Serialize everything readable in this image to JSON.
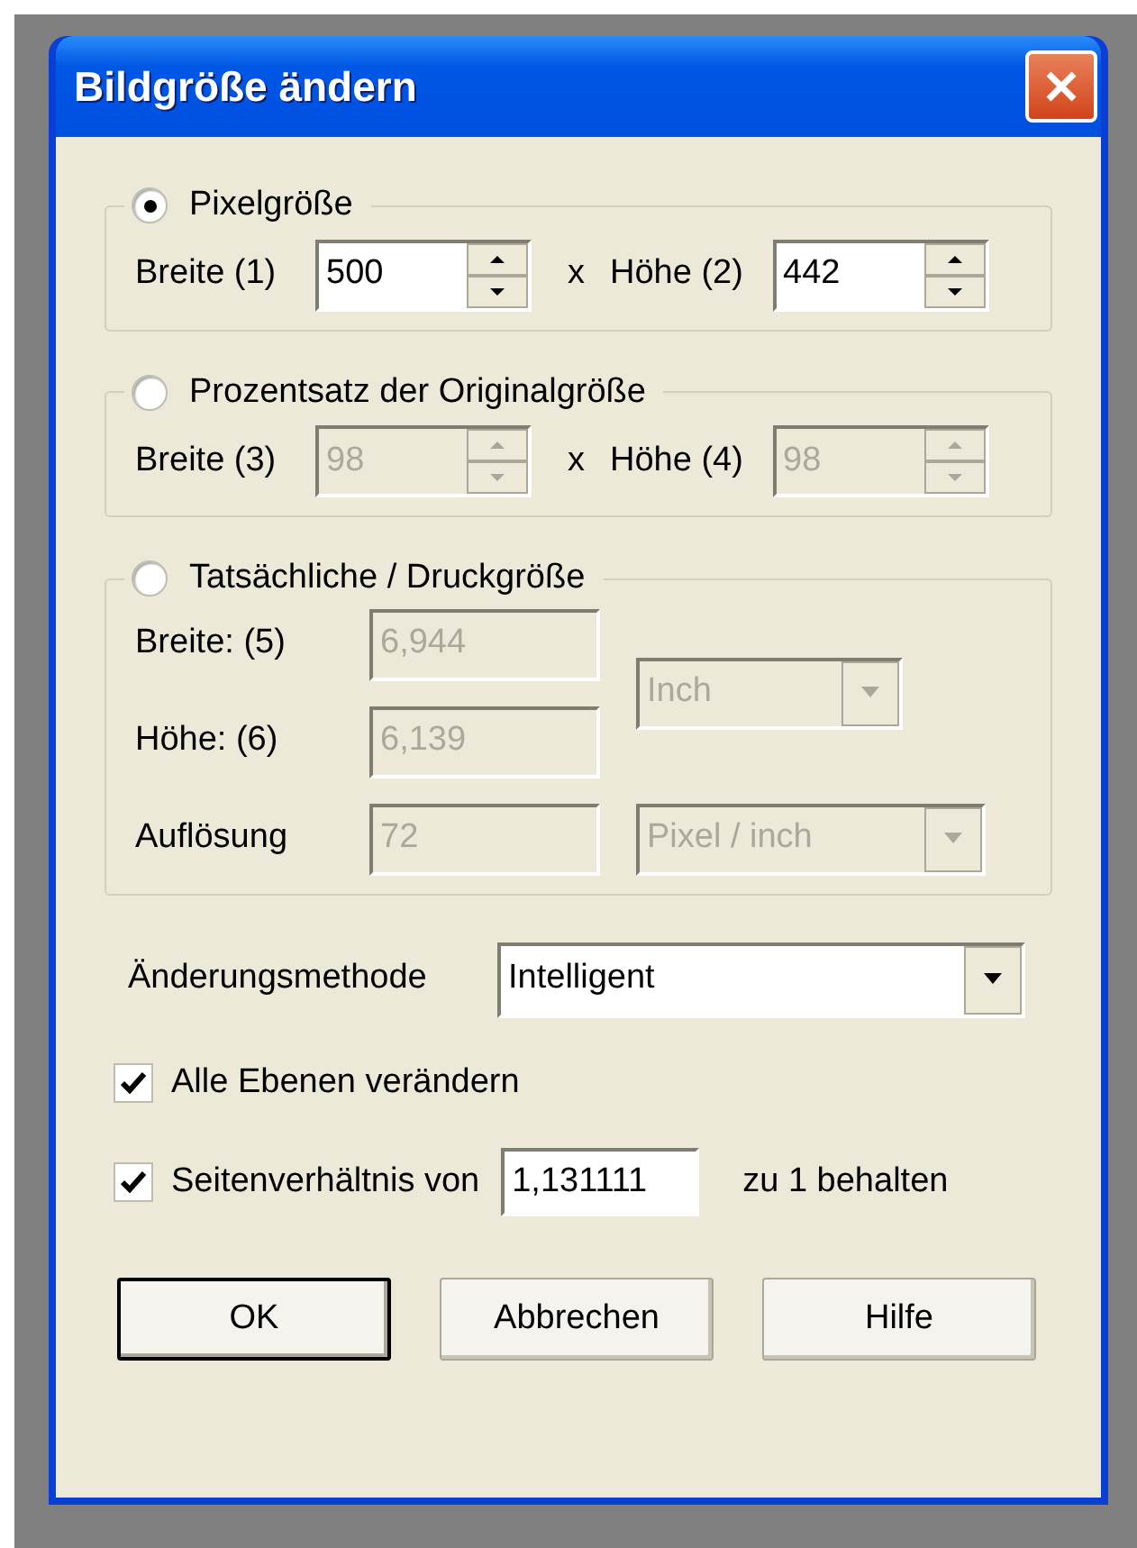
{
  "window": {
    "title": "Bildgröße ändern"
  },
  "groups": [
    {
      "kind": "spin",
      "label": "Pixelgröße",
      "selected": true,
      "separator": "x",
      "fields": [
        {
          "label": "Breite (1)",
          "value": "500",
          "disabled": false
        },
        {
          "label": "Höhe (2)",
          "value": "442",
          "disabled": false
        }
      ]
    },
    {
      "kind": "spin",
      "label": "Prozentsatz der Originalgröße",
      "selected": false,
      "separator": "x",
      "fields": [
        {
          "label": "Breite (3)",
          "value": "98",
          "disabled": true
        },
        {
          "label": "Höhe (4)",
          "value": "98",
          "disabled": true
        }
      ]
    },
    {
      "kind": "print",
      "label": "Tatsächliche / Druckgröße",
      "selected": false,
      "fields": [
        {
          "label": "Breite: (5)",
          "value": "6,944",
          "disabled": true
        },
        {
          "label": "Höhe: (6)",
          "value": "6,139",
          "disabled": true
        },
        {
          "label": "Auflösung",
          "value": "72",
          "disabled": true
        }
      ],
      "units": [
        {
          "value": "Inch",
          "disabled": true
        },
        {
          "value": "Pixel / inch",
          "disabled": true
        }
      ]
    }
  ],
  "method": {
    "label": "Änderungsmethode",
    "value": "Intelligent"
  },
  "options": [
    {
      "kind": "plain",
      "label": "Alle Ebenen verändern",
      "checked": true
    },
    {
      "kind": "ratio",
      "label": "Seitenverhältnis von",
      "value": "1,131111",
      "suffix": "zu 1 behalten",
      "checked": true
    }
  ],
  "buttons": [
    {
      "label": "OK",
      "default": true
    },
    {
      "label": "Abbrechen",
      "default": false
    },
    {
      "label": "Hilfe",
      "default": false
    }
  ]
}
